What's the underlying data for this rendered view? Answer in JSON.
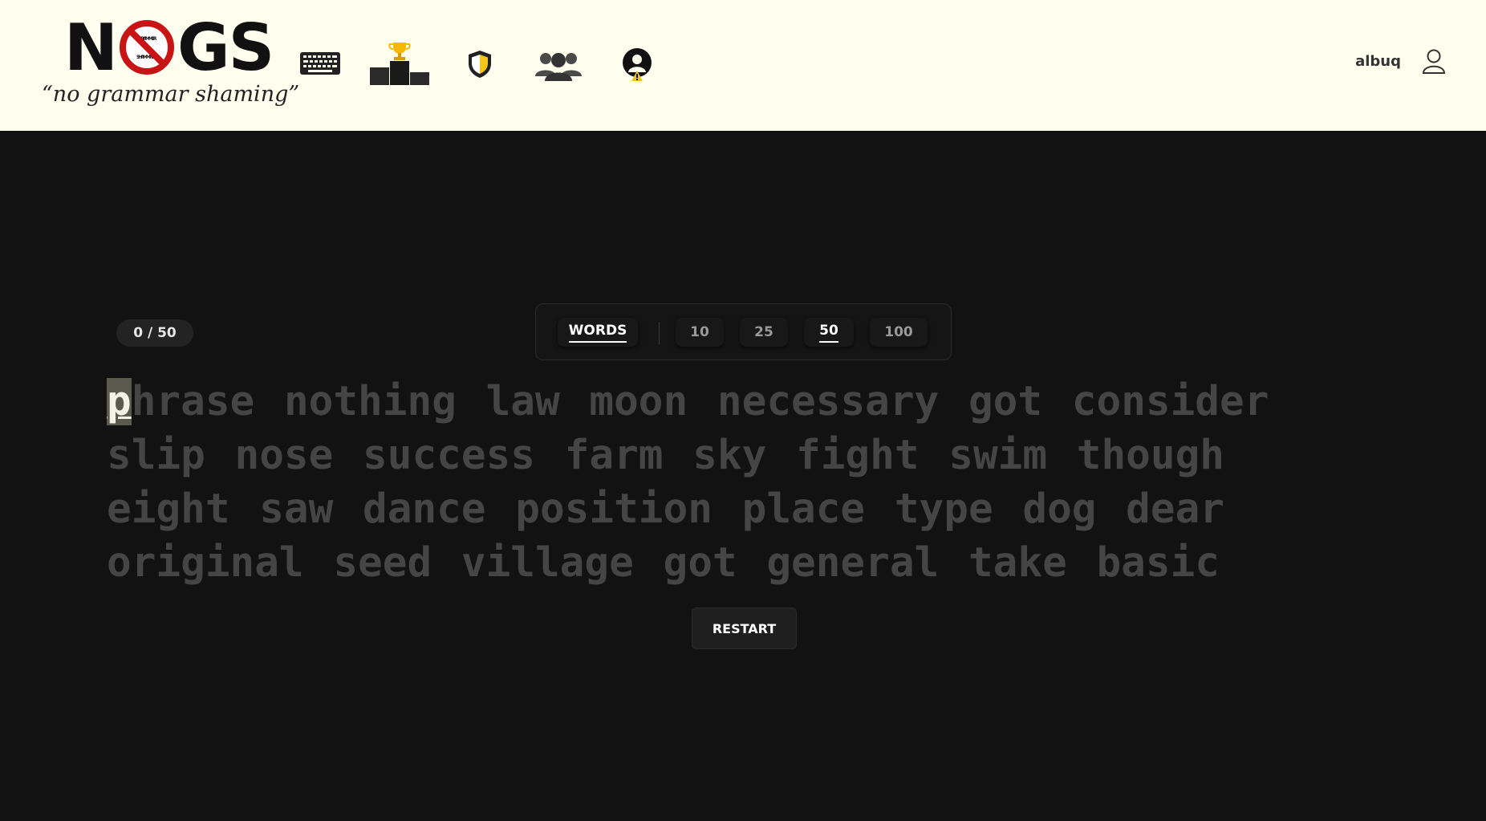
{
  "header": {
    "logo_left": "N",
    "logo_right": "GS",
    "logo_sign_top": "GRAMMER",
    "logo_sign_bottom": "SHAMMING",
    "tagline": "“no grammar shaming”",
    "nav": [
      {
        "icon": "keyboard-icon"
      },
      {
        "icon": "leaderboard-podium-icon"
      },
      {
        "icon": "shield-icon"
      },
      {
        "icon": "group-icon"
      },
      {
        "icon": "profile-alert-icon"
      }
    ],
    "username": "albuq",
    "user_icon": "user-icon"
  },
  "test": {
    "progress": "0 / 50",
    "progress_value": 0,
    "progress_total": 50,
    "mode_label": "WORDS",
    "counts": [
      "10",
      "25",
      "50",
      "100"
    ],
    "selected_count": "50",
    "caret_char": "p",
    "lines": [
      "hrase nothing law moon necessary got consider",
      "slip nose success farm sky fight swim though",
      "eight saw dance position place type dog dear",
      "original seed village got general take basic"
    ],
    "restart_label": "RESTART"
  },
  "colors": {
    "header_bg": "#fffff0",
    "page_bg": "#121212",
    "untyped_text": "#454545",
    "caret_bg": "#5a5a4e",
    "accent_gold": "#f5c518"
  }
}
